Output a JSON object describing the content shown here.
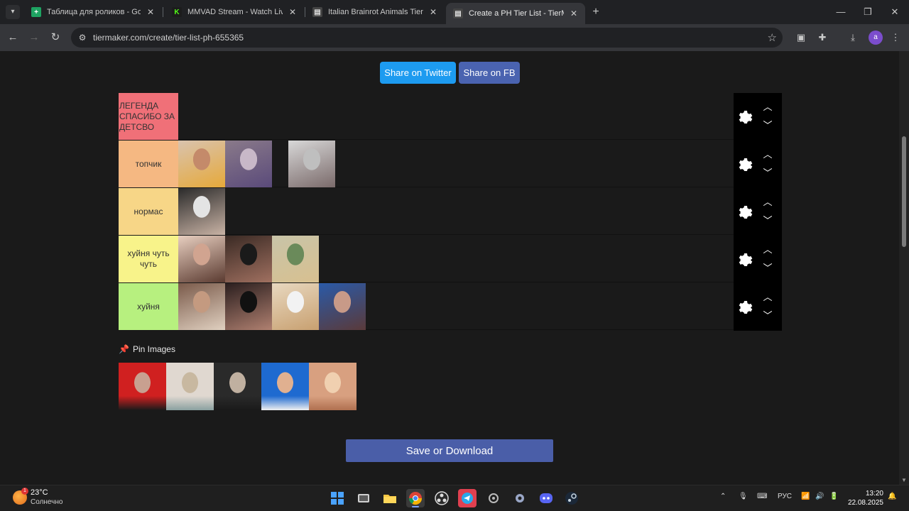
{
  "browser": {
    "tabs": [
      {
        "title": "Таблица для роликов - Google",
        "favicon_color": "#1ea362",
        "favicon_glyph": "+"
      },
      {
        "title": "MMVAD Stream - Watch Live o",
        "favicon_color": "#1c1c1c",
        "favicon_glyph": "K"
      },
      {
        "title": "Italian Brainrot Animals Tier Li",
        "favicon_color": "#2b2b2b",
        "favicon_glyph": "▤"
      },
      {
        "title": "Create a PH Tier List - TierMak",
        "favicon_color": "#2b2b2b",
        "favicon_glyph": "▤",
        "active": true
      }
    ],
    "url": "tiermaker.com/create/tier-list-ph-655365",
    "profile_initial": "a"
  },
  "page": {
    "share_twitter": "Share on Twitter",
    "share_fb": "Share on FB",
    "tiers": [
      {
        "label": "ЛЕГЕНДА СПАСИБО ЗА ДЕТСВО",
        "color": "#f07078",
        "items": []
      },
      {
        "label": "топчик",
        "color": "#f5b882",
        "items": [
          {
            "colors": [
              "#d9c3ae",
              "#e6a93a",
              "#c48a6a"
            ]
          },
          {
            "colors": [
              "#8a7a8a",
              "#5a4a7a",
              "#c8b8c8"
            ]
          },
          {
            "colors": [
              "#d8d8d8",
              "#7a6a6a",
              "#bfbfbf"
            ]
          }
        ]
      },
      {
        "label": "нормас",
        "color": "#f7d687",
        "items": [
          {
            "colors": [
              "#2a2a2a",
              "#c9b3a5",
              "#e4e4e4"
            ]
          }
        ]
      },
      {
        "label": "хуйня чуть чуть",
        "color": "#f8f38a",
        "items": [
          {
            "colors": [
              "#e8cfc0",
              "#5a3a30",
              "#d1a490"
            ]
          },
          {
            "colors": [
              "#3a2a24",
              "#a07060",
              "#1a1a1a"
            ]
          },
          {
            "colors": [
              "#c8c4a8",
              "#d8c090",
              "#6a8a5a"
            ]
          }
        ]
      },
      {
        "label": "хуйня",
        "color": "#b7f07f",
        "items": [
          {
            "colors": [
              "#7a5a4a",
              "#e0d0c0",
              "#c49a80"
            ]
          },
          {
            "colors": [
              "#2a1e1e",
              "#b08070",
              "#111"
            ]
          },
          {
            "colors": [
              "#e8d8c0",
              "#c8a070",
              "#f2f2f2"
            ]
          },
          {
            "colors": [
              "#2a5aa8",
              "#5a3a3a",
              "#c89a88"
            ]
          }
        ]
      }
    ],
    "pin_label": "Pin Images",
    "pinned": [
      {
        "colors": [
          "#d02020",
          "#c8a090",
          "#1a1a1a"
        ]
      },
      {
        "colors": [
          "#e0d8d0",
          "#c8b8a0",
          "#8aa0a0"
        ]
      },
      {
        "colors": [
          "#2a2a2a",
          "#c0b0a0",
          "#1a1a1a"
        ]
      },
      {
        "colors": [
          "#1e6ad0",
          "#e0b090",
          "#f0f0f0"
        ]
      },
      {
        "colors": [
          "#d8a080",
          "#f0d0b0",
          "#b07050"
        ]
      }
    ],
    "save_label": "Save or Download"
  },
  "taskbar": {
    "temp": "23°C",
    "weather": "Солнечно",
    "weather_badge": "1",
    "lang": "РУС",
    "time": "13:20",
    "date": "22.08.2025"
  }
}
